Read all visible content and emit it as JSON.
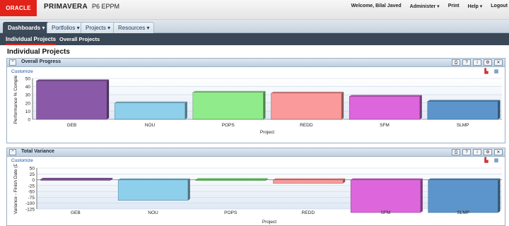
{
  "header": {
    "logo": "ORACLE",
    "product_name": "PRIMAVERA",
    "product_suffix": "P6 EPPM",
    "links": [
      "Welcome, Bilal Javed",
      "Administer ▾",
      "Print",
      "Help ▾",
      "Logout"
    ]
  },
  "nav": {
    "tabs": [
      {
        "label": "Dashboards ▾",
        "active": true
      },
      {
        "label": "Portfolios ▾",
        "active": false
      },
      {
        "label": "Projects ▾",
        "active": false
      },
      {
        "label": "Resources ▾",
        "active": false
      }
    ],
    "subtabs": [
      {
        "label": "Individual Projects",
        "active": true
      },
      {
        "label": "Overall Projects",
        "active": false
      }
    ]
  },
  "page_title": "Individual Projects",
  "portlets": [
    {
      "title": "Overall Progress",
      "customize": "Customize"
    },
    {
      "title": "Total Variance",
      "customize": "Customize"
    }
  ],
  "colors": {
    "GEB": "#8a5aa8",
    "NOU": "#8ed0ec",
    "POPS": "#90ec8a",
    "REDD": "#fb9a9a",
    "SFM": "#dd66dd",
    "SLMP": "#5b95cc"
  },
  "chart_data": [
    {
      "type": "bar",
      "categories": [
        "GEB",
        "NOU",
        "POPS",
        "REDD",
        "SFM",
        "SLMP"
      ],
      "values": [
        47,
        20,
        33,
        32,
        28,
        22
      ],
      "xlabel": "Project",
      "ylabel": "Performance % Complet",
      "ylim": [
        0,
        50
      ],
      "yticks": [
        "0",
        "10",
        "20",
        "30",
        "40",
        "50"
      ],
      "grid": true
    },
    {
      "type": "bar",
      "categories": [
        "GEB",
        "NOU",
        "POPS",
        "REDD",
        "SFM",
        "SLMP"
      ],
      "values": [
        2,
        -88,
        1,
        -15,
        -140,
        -140
      ],
      "xlabel": "Project",
      "ylabel": "Variance - Finish Date (D",
      "ylim": [
        -125,
        50
      ],
      "yticks": [
        "-125",
        "-100",
        "-75",
        "-50",
        "-25",
        "0",
        "25",
        "50"
      ],
      "grid": true
    }
  ]
}
